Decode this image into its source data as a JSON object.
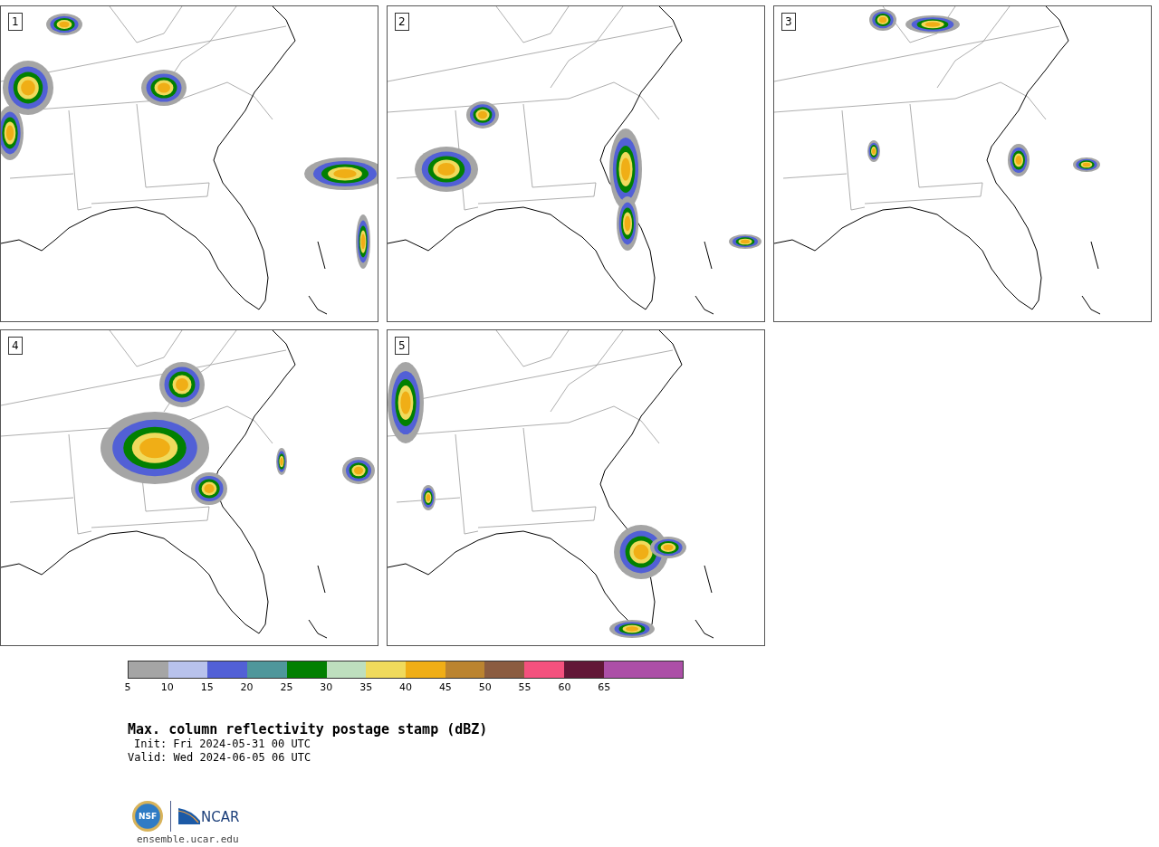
{
  "panels": [
    {
      "label": "1"
    },
    {
      "label": "2"
    },
    {
      "label": "3"
    },
    {
      "label": "4"
    },
    {
      "label": "5"
    }
  ],
  "colorbar": {
    "bins": [
      {
        "label": "5",
        "color": "#a5a5a5"
      },
      {
        "label": "10",
        "color": "#b8c2ec"
      },
      {
        "label": "15",
        "color": "#5260d6"
      },
      {
        "label": "20",
        "color": "#4f979b"
      },
      {
        "label": "25",
        "color": "#028001"
      },
      {
        "label": "30",
        "color": "#bedfbe"
      },
      {
        "label": "35",
        "color": "#f0da5c"
      },
      {
        "label": "40",
        "color": "#f0ae16"
      },
      {
        "label": "45",
        "color": "#bb8430"
      },
      {
        "label": "50",
        "color": "#8b5c40"
      },
      {
        "label": "55",
        "color": "#f4517e"
      },
      {
        "label": "60",
        "color": "#621737"
      },
      {
        "label": "65",
        "color": "#ac4fa7"
      },
      {
        "color": "#ac4fa7"
      }
    ]
  },
  "title": "Max. column reflectivity postage stamp (dBZ)",
  "init": "Init: Fri 2024-05-31 00 UTC",
  "valid": "Valid: Wed 2024-06-05 06 UTC",
  "logos": {
    "nsf": "NSF",
    "ncar": "NCAR"
  },
  "url": "ensemble.ucar.edu"
}
